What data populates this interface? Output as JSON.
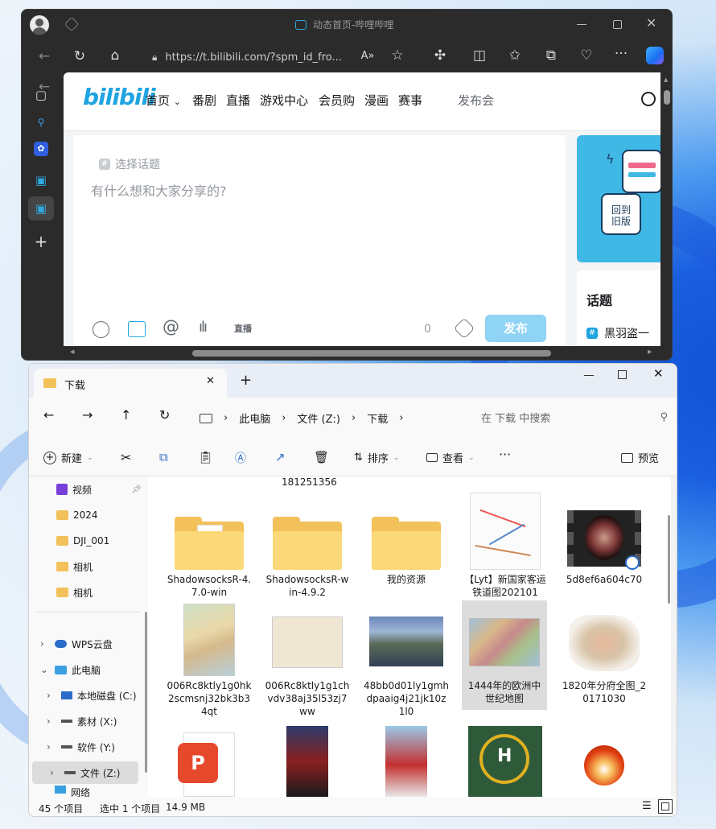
{
  "browser": {
    "tab_title": "动态首页-哔哩哔哩",
    "address": "https://t.bilibili.com/?spm_id_fro...",
    "address_host": "t.bilibili.com",
    "bilibili": {
      "logo": "bilibili",
      "nav": [
        "首页",
        "番剧",
        "直播",
        "游戏中心",
        "会员购",
        "漫画",
        "赛事"
      ],
      "nav_extra": "发布会",
      "topic_select": "选择话题",
      "composer_placeholder": "有什么想和大家分享的?",
      "char_count": "0",
      "publish_button": "发布",
      "banner_text": [
        "回到",
        "旧版"
      ],
      "topic_title": "话题",
      "topic_item": "黑羽盗一"
    }
  },
  "explorer": {
    "tab_title": "下载",
    "breadcrumb": [
      "此电脑",
      "文件 (Z:)",
      "下载"
    ],
    "search_placeholder": "在 下载 中搜索",
    "commands": {
      "new": "新建",
      "sort": "排序",
      "view": "查看",
      "preview": "预览"
    },
    "tree": [
      "视频",
      "2024",
      "DJI_001",
      "相机",
      "相机",
      "WPS云盘",
      "此电脑",
      "本地磁盘 (C:)",
      "素材 (X:)",
      "软件 (Y:)",
      "文件 (Z:)",
      "网络"
    ],
    "partial_label": "181251356",
    "files": [
      "ShadowsocksR-4.7.0-win",
      "ShadowsocksR-win-4.9.2",
      "我的资源",
      "【Lyt】新国家客运铁道图202101",
      "5d8ef6a604c70",
      "006Rc8ktly1g0hk2scmsnj32bk3b34qt",
      "006Rc8ktly1g1chvdv38aj35l53zj7ww",
      "48bb0d01ly1gmhdpaaig4j21jk10z1l0",
      "1444年的欧洲中世纪地图",
      "1820年分府全图_20171030"
    ],
    "status": {
      "count": "45 个项目",
      "selected": "选中 1 个项目",
      "size": "14.9 MB"
    }
  }
}
